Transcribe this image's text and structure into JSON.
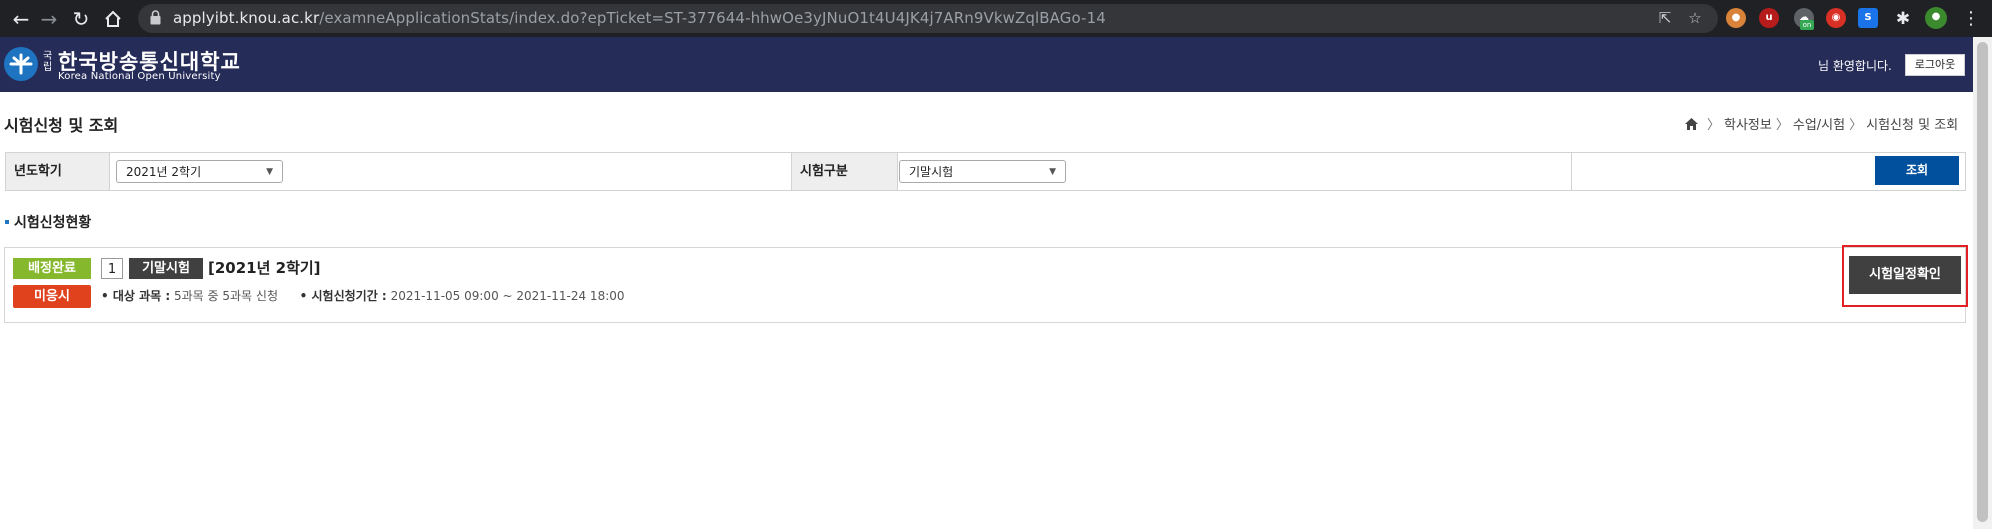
{
  "browser": {
    "url_host": "applyibt.knou.ac.kr",
    "url_path": "/examneApplicationStats/index.do?epTicket=ST-377644-hhwOe3yJNuO1t4U4JK4j7ARn9VkwZqlBAGo-14",
    "icons": [
      "back-icon",
      "forward-icon",
      "reload-icon",
      "home-icon",
      "lock-icon",
      "share-icon",
      "bookmark-star-icon",
      "extension-icon",
      "menu-icon"
    ],
    "extension_badge": "on"
  },
  "header": {
    "logo_small": "국립",
    "logo_korean": "한국방송통신대학교",
    "logo_english": "Korea National Open University",
    "welcome": "님 환영합니다.",
    "logout_label": "로그아웃"
  },
  "page": {
    "title": "시험신청 및 조회",
    "breadcrumb": [
      "학사정보",
      "수업/시험",
      "시험신청 및 조회"
    ]
  },
  "search": {
    "year_term_label": "년도학기",
    "year_term_value": "2021년 2학기",
    "exam_type_label": "시험구분",
    "exam_type_value": "기말시험",
    "search_button": "조회"
  },
  "status": {
    "section_title": "시험신청현황",
    "badge_assigned": "배정완료",
    "badge_absent": "미응시",
    "round_number": "1",
    "exam_type_tag": "기말시험",
    "term": "[2021년 2학기]",
    "subjects_label": "• 대상 과목 :",
    "subjects_value": "5과목 중 5과목 신청",
    "period_label": "• 시험신청기간 :",
    "period_value": "2021-11-05 09:00 ~ 2021-11-24 18:00",
    "schedule_button": "시험일정확인"
  },
  "colors": {
    "header_bg": "#262c58",
    "badge_assigned": "#86b82d",
    "badge_absent": "#e0421e",
    "search_button": "#00509d",
    "highlight": "#e31e24"
  }
}
